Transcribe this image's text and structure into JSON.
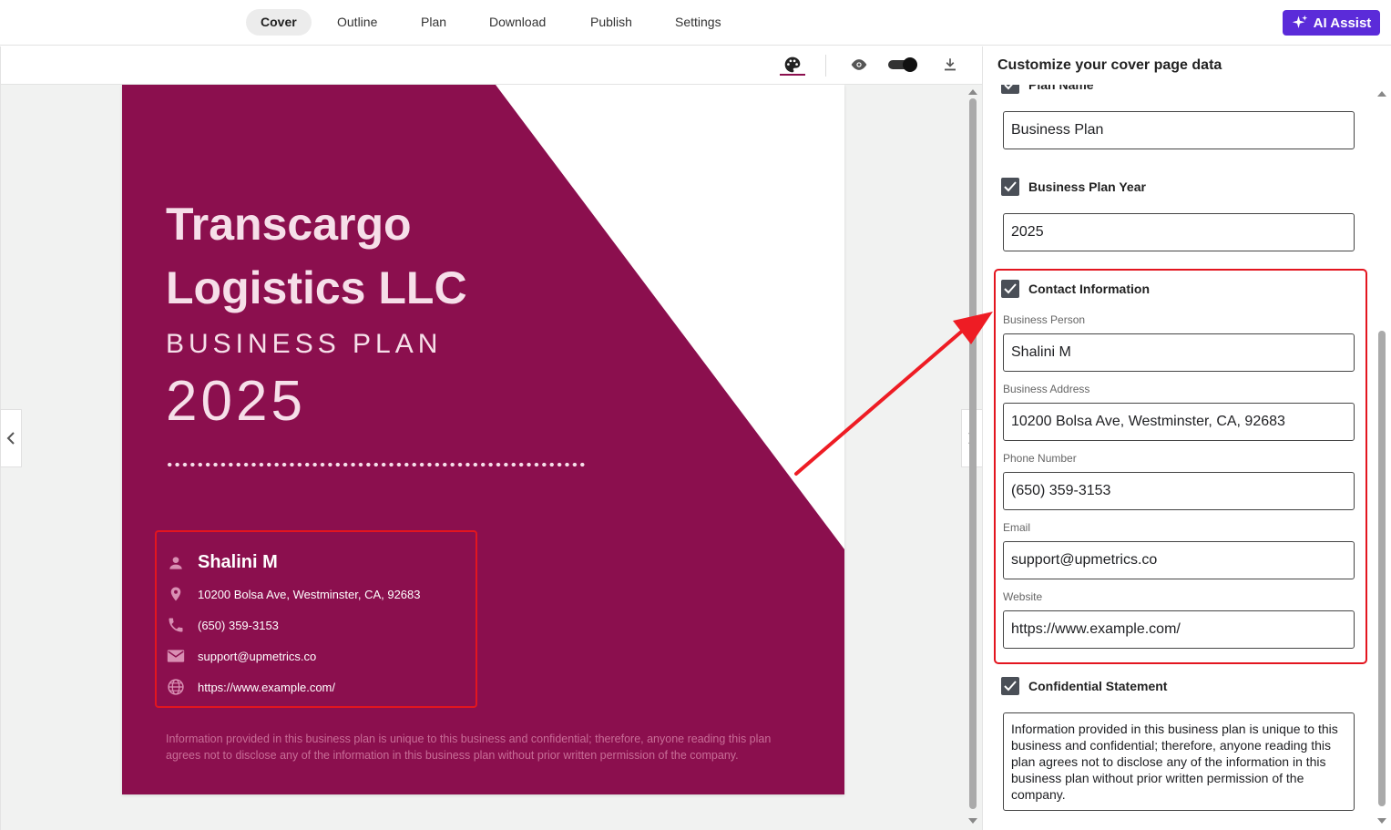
{
  "nav": {
    "tabs": [
      {
        "label": "Cover",
        "active": true
      },
      {
        "label": "Outline",
        "active": false
      },
      {
        "label": "Plan",
        "active": false
      },
      {
        "label": "Download",
        "active": false
      },
      {
        "label": "Publish",
        "active": false
      },
      {
        "label": "Settings",
        "active": false
      }
    ],
    "ai_button": "AI Assist"
  },
  "toolbar": {
    "icons": [
      "palette-icon",
      "eye-icon",
      "toggle-switch",
      "download-icon"
    ]
  },
  "cover": {
    "company_line1": "Transcargo",
    "company_line2": "Logistics LLC",
    "doc_type": "BUSINESS PLAN",
    "year": "2025",
    "contact": {
      "person": "Shalini M",
      "address": "10200 Bolsa Ave, Westminster, CA, 92683",
      "phone": "(650) 359-3153",
      "email": "support@upmetrics.co",
      "website": "https://www.example.com/"
    },
    "confidential": "Information provided in this business plan is unique to this business and confidential; therefore, anyone reading this plan agrees not to disclose any of the information in this business plan without prior written permission of the company.",
    "colors": {
      "primary": "#8b0f4e",
      "text": "#f6dfe9"
    }
  },
  "panel": {
    "title": "Customize your cover page data",
    "plan_name_label": "Plan Name",
    "plan_name_value": "Business Plan",
    "plan_year_label": "Business Plan Year",
    "plan_year_value": "2025",
    "contact_label": "Contact Information",
    "person_label": "Business Person",
    "person_value": "Shalini M",
    "address_label": "Business Address",
    "address_value": "10200 Bolsa Ave, Westminster, CA, 92683",
    "phone_label": "Phone Number",
    "phone_value": "(650) 359-3153",
    "email_label": "Email",
    "email_value": "support@upmetrics.co",
    "website_label": "Website",
    "website_value": "https://www.example.com/",
    "confidential_label": "Confidential Statement",
    "confidential_value": "Information provided in this business plan is unique to this business and confidential; therefore, anyone reading this plan agrees not to disclose any of the information in this business plan without prior written permission of the company."
  }
}
